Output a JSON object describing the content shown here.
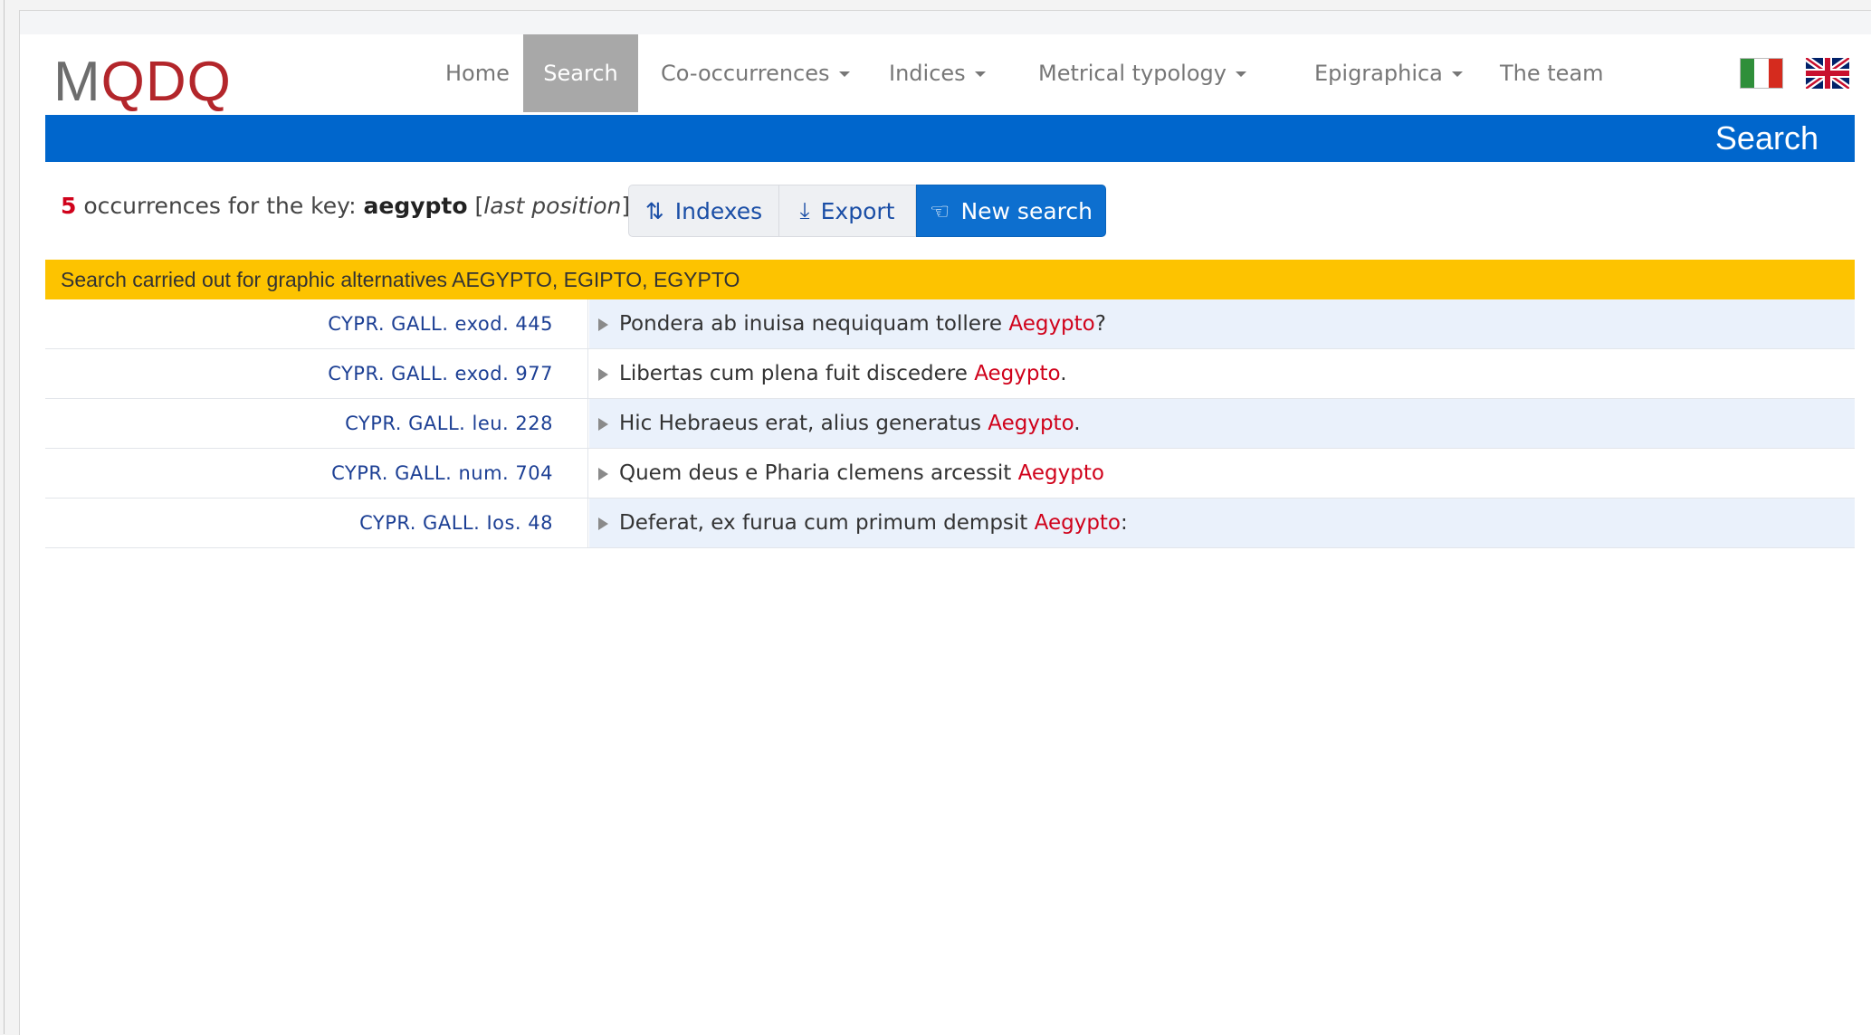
{
  "logo": {
    "part1": "M",
    "part2": "QDQ"
  },
  "nav": {
    "home": "Home",
    "search": "Search",
    "cooccurrences": "Co-occurrences",
    "indices": "Indices",
    "metrical": "Metrical typology",
    "epigraphica": "Epigraphica",
    "team": "The team"
  },
  "languages": [
    "Italiano",
    "English"
  ],
  "page_title": "Search",
  "summary": {
    "count": "5",
    "text": "occurrences for the key:",
    "key": "aegypto",
    "position": "last position"
  },
  "buttons": {
    "indexes": "Indexes",
    "export": "Export",
    "new_search": "New search"
  },
  "alert": "Search carried out for graphic alternatives AEGYPTO, EGIPTO, EGYPTO",
  "results": [
    {
      "ref": "CYPR. GALL. exod. 445",
      "before": "Pondera ab inuisa nequiquam tollere ",
      "match": "Aegypto",
      "after": "?"
    },
    {
      "ref": "CYPR. GALL. exod. 977",
      "before": "Libertas cum plena fuit discedere ",
      "match": "Aegypto",
      "after": "."
    },
    {
      "ref": "CYPR. GALL. leu. 228",
      "before": "Hic Hebraeus erat, alius generatus ",
      "match": "Aegypto",
      "after": "."
    },
    {
      "ref": "CYPR. GALL. num. 704",
      "before": "Quem deus e Pharia clemens arcessit ",
      "match": "Aegypto",
      "after": ""
    },
    {
      "ref": "CYPR. GALL. Ios. 48",
      "before": "Deferat, ex furua cum primum dempsit ",
      "match": "Aegypto",
      "after": ":"
    }
  ],
  "colors": {
    "brand_blue": "#0066cc",
    "alert_yellow": "#fdc300",
    "highlight_red": "#d0021b",
    "ref_blue": "#1c3f94"
  }
}
